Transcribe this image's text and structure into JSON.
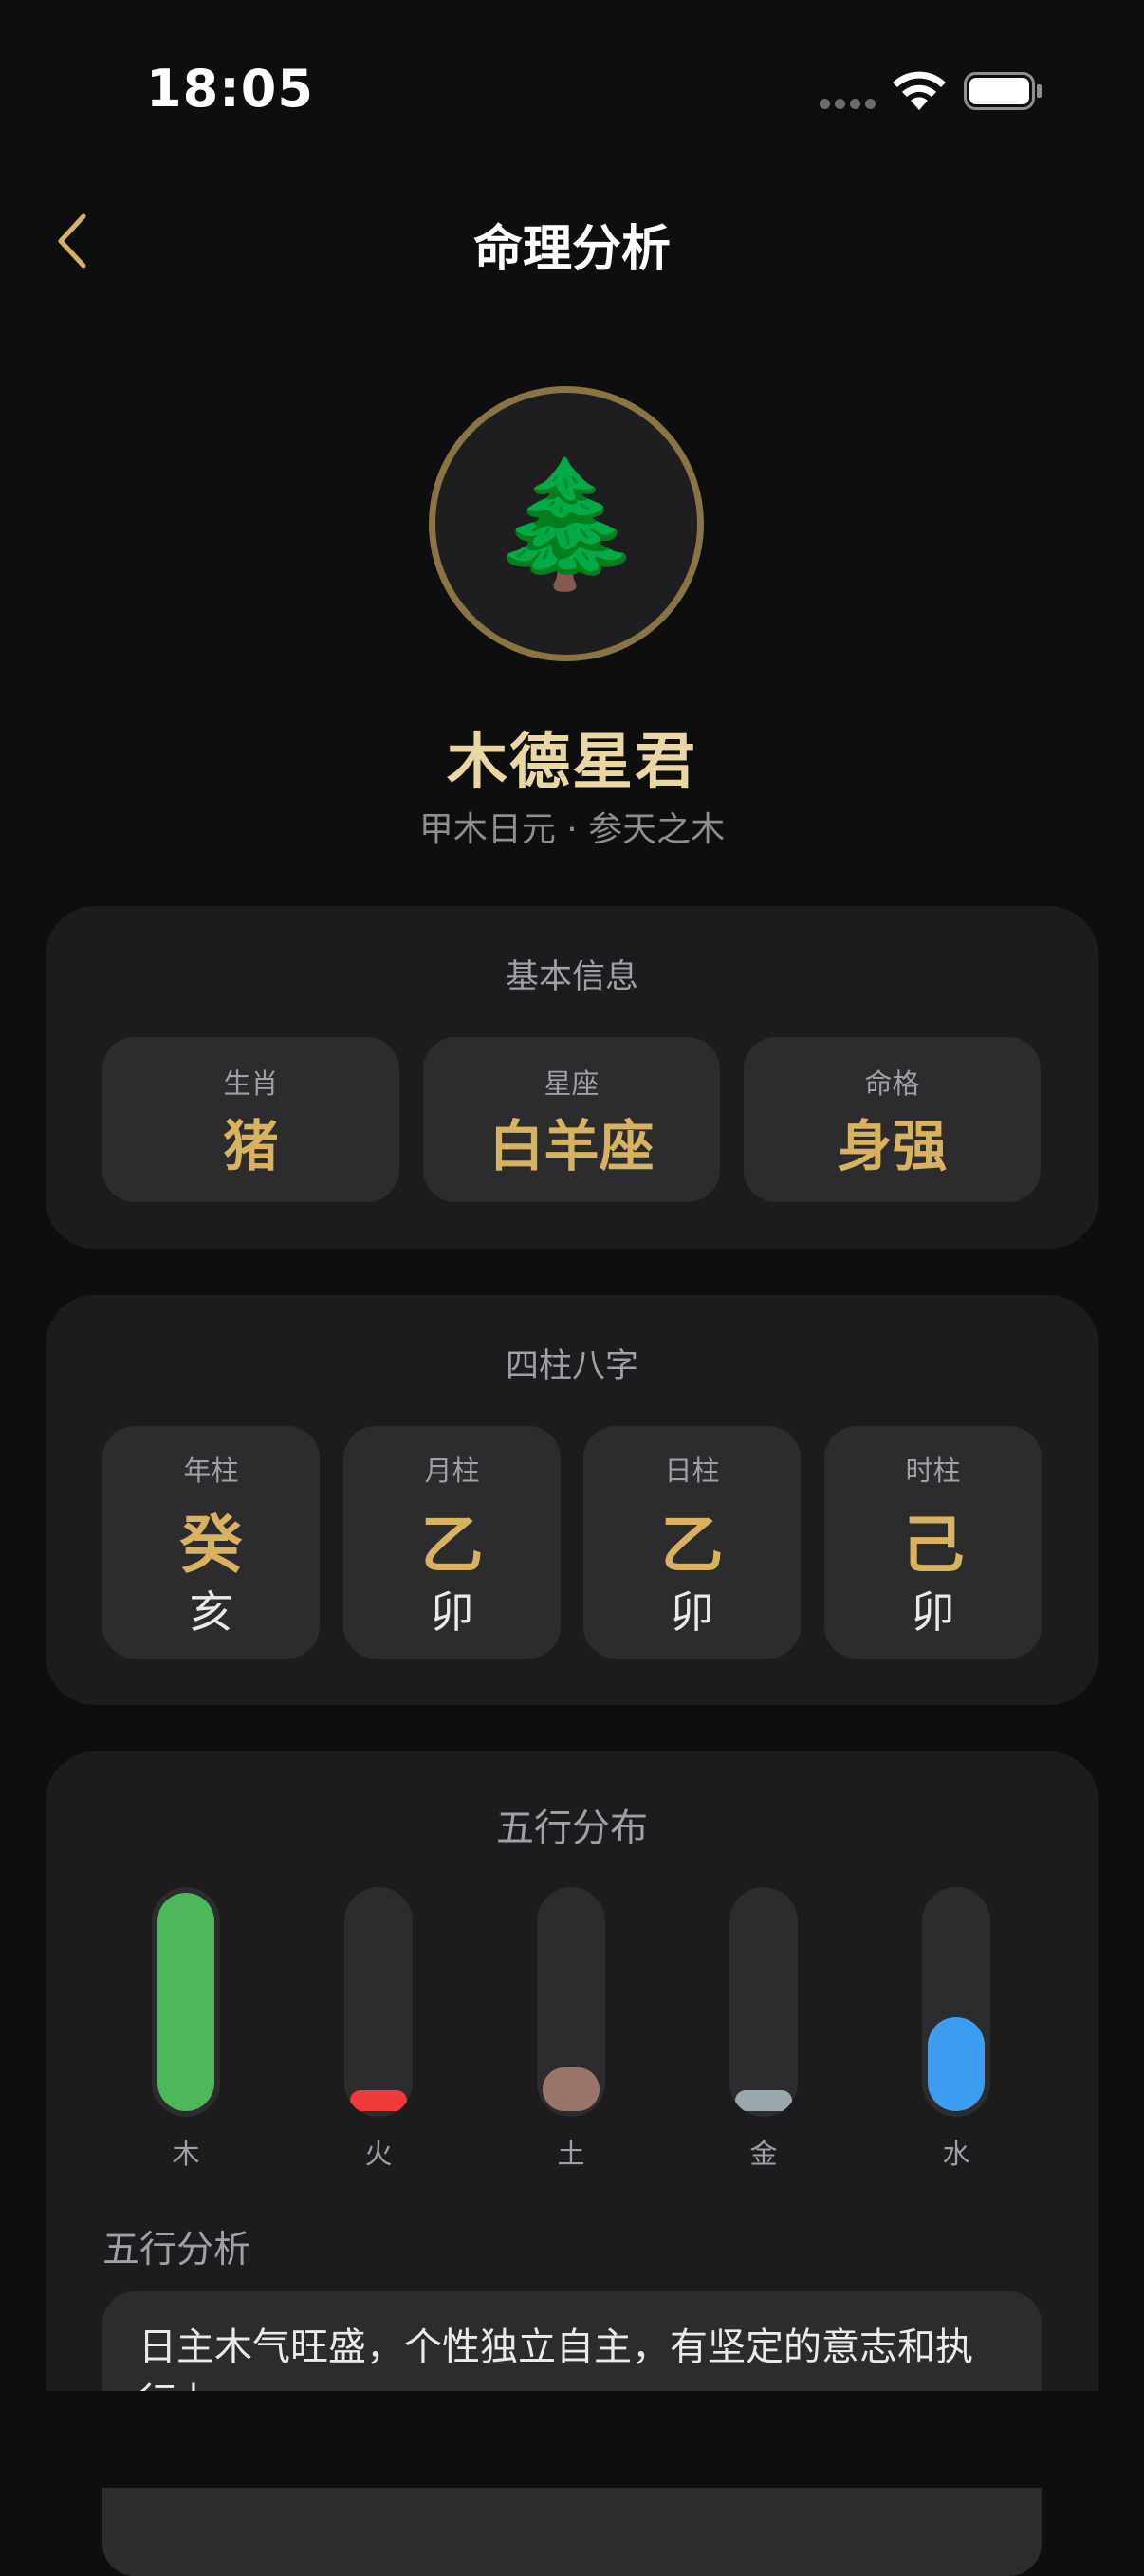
{
  "status_bar": {
    "time": "18:05",
    "icons": [
      "signal-dots-icon",
      "wifi-icon",
      "battery-icon"
    ]
  },
  "nav": {
    "title": "命理分析",
    "back_icon": "chevron-left-icon"
  },
  "profile": {
    "avatar_glyph": "🌲",
    "name": "木德星君",
    "subtitle": "甲木日元 · 参天之木"
  },
  "basic_info": {
    "title": "基本信息",
    "items": [
      {
        "label": "生肖",
        "value": "猪"
      },
      {
        "label": "星座",
        "value": "白羊座"
      },
      {
        "label": "命格",
        "value": "身强"
      }
    ]
  },
  "four_pillars": {
    "title": "四柱八字",
    "pillars": [
      {
        "label": "年柱",
        "stem": "癸",
        "branch": "亥"
      },
      {
        "label": "月柱",
        "stem": "乙",
        "branch": "卯"
      },
      {
        "label": "日柱",
        "stem": "乙",
        "branch": "卯"
      },
      {
        "label": "时柱",
        "stem": "己",
        "branch": "卯"
      }
    ]
  },
  "five_elements": {
    "title": "五行分布",
    "elements": [
      {
        "name": "木",
        "level": 1.0,
        "color": "#4cb85a"
      },
      {
        "name": "火",
        "level": 0.08,
        "color": "#f0393a"
      },
      {
        "name": "土",
        "level": 0.2,
        "color": "#9a7468"
      },
      {
        "name": "金",
        "level": 0.08,
        "color": "#9aa9ae"
      },
      {
        "name": "水",
        "level": 0.43,
        "color": "#3d9df2"
      }
    ],
    "analysis_heading": "五行分析",
    "analysis_text": "日主木气旺盛，个性独立自主，有坚定的意志和执行力。"
  },
  "colors": {
    "accent_gold": "#d8b25f",
    "name_gold": "#ead7a4",
    "avatar_ring": "#8a7444",
    "card_bg": "#1c1c1e",
    "tile_bg": "#2c2c2e"
  }
}
